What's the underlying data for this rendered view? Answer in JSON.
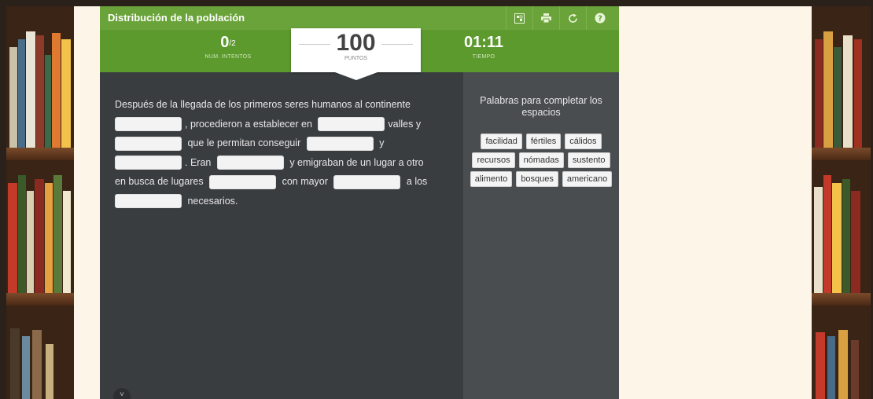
{
  "header": {
    "title": "Distribución de la población",
    "icons": [
      "mosaic-icon",
      "print-icon",
      "refresh-icon",
      "help-icon"
    ]
  },
  "score": {
    "attempts": "0",
    "attempts_max": "/2",
    "attempts_label": "NUM. INTENTOS",
    "points": "100",
    "points_label": "PUNTOS",
    "time": "01:11",
    "time_label": "TIEMPO"
  },
  "exercise": {
    "segments": [
      "Después de la llegada de los primeros seres humanos al continente",
      ", procedieron a establecer en",
      "valles y",
      "que le permitan conseguir",
      "y",
      ". Eran",
      "y emigraban de un lugar a otro",
      "en busca de lugares",
      "con mayor",
      "a los",
      "necesarios."
    ]
  },
  "words_panel": {
    "title": "Palabras para completar los espacios",
    "words": [
      "facilidad",
      "fértiles",
      "cálidos",
      "recursos",
      "nómadas",
      "sustento",
      "alimento",
      "bosques",
      "americano"
    ]
  },
  "colors": {
    "title_bar": "#6aa33a",
    "score_bar": "#5c9a2e",
    "content_bg": "#3a3d40",
    "panel_bg": "#4a4d50"
  }
}
